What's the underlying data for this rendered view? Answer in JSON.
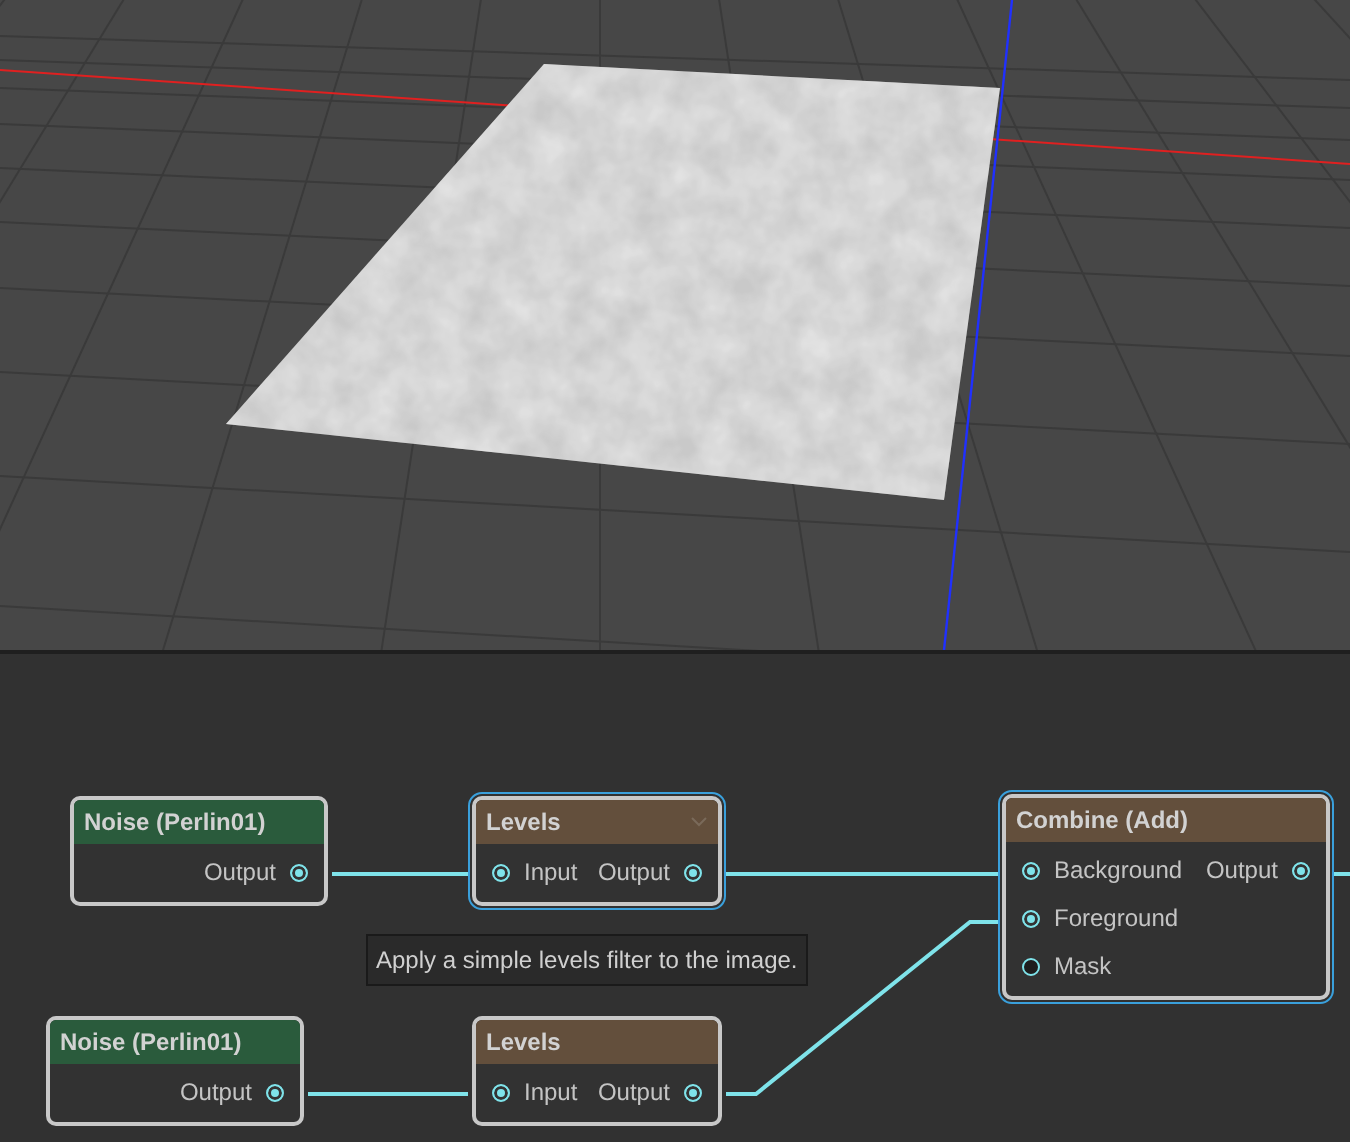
{
  "graph": {
    "nodes": [
      {
        "title": "Noise (Perlin01)",
        "kind": "generator",
        "selected": false,
        "hovered": false,
        "outputs": [
          {
            "label": "Output",
            "connected": true
          }
        ]
      },
      {
        "title": "Levels",
        "kind": "filter",
        "selected": true,
        "hovered": true,
        "inputs": [
          {
            "label": "Input",
            "connected": true
          }
        ],
        "outputs": [
          {
            "label": "Output",
            "connected": true
          }
        ]
      },
      {
        "title": "Combine (Add)",
        "kind": "filter",
        "selected": true,
        "hovered": false,
        "inputs": [
          {
            "label": "Background",
            "connected": true
          },
          {
            "label": "Foreground",
            "connected": true
          },
          {
            "label": "Mask",
            "connected": false
          }
        ],
        "outputs": [
          {
            "label": "Output",
            "connected": true
          }
        ]
      },
      {
        "title": "Noise (Perlin01)",
        "kind": "generator",
        "selected": false,
        "hovered": false,
        "outputs": [
          {
            "label": "Output",
            "connected": true
          }
        ]
      },
      {
        "title": "Levels",
        "kind": "filter",
        "selected": false,
        "hovered": false,
        "inputs": [
          {
            "label": "Input",
            "connected": true
          }
        ],
        "outputs": [
          {
            "label": "Output",
            "connected": true
          }
        ]
      }
    ],
    "tooltip": "Apply a simple levels filter to the image."
  }
}
